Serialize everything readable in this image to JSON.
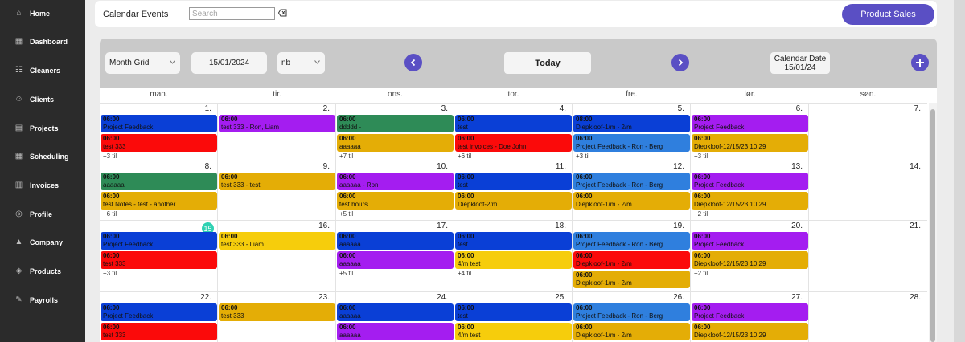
{
  "colors": {
    "purple": "#5a4fc4",
    "blue": "#0a3fd6",
    "violet": "#a41df0",
    "green": "#2e8b57",
    "amber": "#e4ad06",
    "red": "#fb0a0a",
    "mid_blue": "#2f7fde",
    "yellow": "#f6cd0c",
    "today": "#2ed1b2"
  },
  "nav": [
    {
      "label": "Home",
      "icon": "home-icon"
    },
    {
      "label": "Dashboard",
      "icon": "dashboard-icon"
    },
    {
      "label": "Cleaners",
      "icon": "cleaners-icon"
    },
    {
      "label": "Clients",
      "icon": "clients-icon"
    },
    {
      "label": "Projects",
      "icon": "projects-icon"
    },
    {
      "label": "Scheduling",
      "icon": "scheduling-icon"
    },
    {
      "label": "Invoices",
      "icon": "invoices-icon"
    },
    {
      "label": "Profile",
      "icon": "profile-icon"
    },
    {
      "label": "Company",
      "icon": "company-icon"
    },
    {
      "label": "Products",
      "icon": "products-icon"
    },
    {
      "label": "Payrolls",
      "icon": "payrolls-icon"
    }
  ],
  "header": {
    "title": "Calendar Events",
    "search_placeholder": "Search",
    "product_sales": "Product Sales"
  },
  "toolbar": {
    "view": "Month Grid",
    "date": "15/01/2024",
    "lang": "nb",
    "today": "Today",
    "cal_date_label": "Calendar Date",
    "cal_date_value": "15/01/24"
  },
  "weekdays": [
    "man.",
    "tir.",
    "ons.",
    "tor.",
    "fre.",
    "lør.",
    "søn."
  ],
  "today_day": "15",
  "weeks": [
    {
      "days": [
        "1.",
        "2.",
        "3.",
        "4.",
        "5.",
        "6.",
        "7."
      ],
      "cells": [
        {
          "events": [
            {
              "time": "06:00",
              "title": "Project Feedback",
              "color": "blue"
            },
            {
              "time": "06:00",
              "title": "test 333",
              "color": "red"
            }
          ],
          "more": "+3 til"
        },
        {
          "events": [
            {
              "time": "06:00",
              "title": "test 333 - Ron, Liam",
              "color": "violet"
            }
          ],
          "more": ""
        },
        {
          "events": [
            {
              "time": "06:00",
              "title": "ddddd -",
              "color": "green"
            },
            {
              "time": "06:00",
              "title": "aaaaaa",
              "color": "amber"
            }
          ],
          "more": "+7 til"
        },
        {
          "events": [
            {
              "time": "06:00",
              "title": "test",
              "color": "blue"
            },
            {
              "time": "06:00",
              "title": "test invoices - Doe John",
              "color": "red"
            }
          ],
          "more": "+6 til"
        },
        {
          "events": [
            {
              "time": "08:00",
              "title": "Diepkloof-1/m - 2/m",
              "color": "blue"
            },
            {
              "time": "06:00",
              "title": "Project Feedback - Ron - Berg",
              "color": "mid_blue"
            }
          ],
          "more": "+3 til"
        },
        {
          "events": [
            {
              "time": "06:00",
              "title": "Project Feedback",
              "color": "violet"
            },
            {
              "time": "06:00",
              "title": "Diepkloof-12/15/23 10:29",
              "color": "amber"
            }
          ],
          "more": "+3 til"
        },
        {
          "events": [],
          "more": ""
        }
      ]
    },
    {
      "days": [
        "8.",
        "9.",
        "10.",
        "11.",
        "12.",
        "13.",
        "14."
      ],
      "cells": [
        {
          "events": [
            {
              "time": "06:00",
              "title": "aaaaaa",
              "color": "green"
            },
            {
              "time": "06:00",
              "title": "test Notes - test - another",
              "color": "amber"
            }
          ],
          "more": "+6 til"
        },
        {
          "events": [
            {
              "time": "06:00",
              "title": "test 333 - test",
              "color": "amber"
            }
          ],
          "more": ""
        },
        {
          "events": [
            {
              "time": "06:00",
              "title": "aaaaaa - Ron",
              "color": "violet"
            },
            {
              "time": "06:00",
              "title": "test hours",
              "color": "amber"
            }
          ],
          "more": "+5 til"
        },
        {
          "events": [
            {
              "time": "06:00",
              "title": "test",
              "color": "blue"
            },
            {
              "time": "06:00",
              "title": "Diepkloof-2/m",
              "color": "amber"
            }
          ],
          "more": ""
        },
        {
          "events": [
            {
              "time": "06:00",
              "title": "Project Feedback - Ron - Berg",
              "color": "mid_blue"
            },
            {
              "time": "06:00",
              "title": "Diepkloof-1/m - 2/m",
              "color": "amber"
            }
          ],
          "more": ""
        },
        {
          "events": [
            {
              "time": "06:00",
              "title": "Project Feedback",
              "color": "violet"
            },
            {
              "time": "06:00",
              "title": "Diepkloof-12/15/23 10:29",
              "color": "amber"
            }
          ],
          "more": "+2 til"
        },
        {
          "events": [],
          "more": ""
        }
      ]
    },
    {
      "days": [
        "",
        "16.",
        "17.",
        "18.",
        "19.",
        "20.",
        "21."
      ],
      "cells": [
        {
          "events": [
            {
              "time": "06:00",
              "title": "Project Feedback",
              "color": "blue"
            },
            {
              "time": "06:00",
              "title": "test 333",
              "color": "red"
            }
          ],
          "more": "+3 til"
        },
        {
          "events": [
            {
              "time": "06:00",
              "title": "test 333 - Liam",
              "color": "yellow"
            }
          ],
          "more": ""
        },
        {
          "events": [
            {
              "time": "06:00",
              "title": "aaaaaa",
              "color": "blue"
            },
            {
              "time": "06:00",
              "title": "aaaaaa",
              "color": "violet"
            }
          ],
          "more": "+5 til"
        },
        {
          "events": [
            {
              "time": "06:00",
              "title": "test",
              "color": "blue"
            },
            {
              "time": "06:00",
              "title": "4/m test",
              "color": "yellow"
            }
          ],
          "more": "+4 til"
        },
        {
          "events": [
            {
              "time": "06:00",
              "title": "Project Feedback - Ron - Berg",
              "color": "mid_blue"
            },
            {
              "time": "06:00",
              "title": "Diepkloof-1/m - 2/m",
              "color": "red"
            },
            {
              "time": "06:00",
              "title": "Diepkloof-1/m - 2/m",
              "color": "amber"
            }
          ],
          "more": ""
        },
        {
          "events": [
            {
              "time": "06:00",
              "title": "Project Feedback",
              "color": "violet"
            },
            {
              "time": "06:00",
              "title": "Diepkloof-12/15/23 10:29",
              "color": "amber"
            }
          ],
          "more": "+2 til"
        },
        {
          "events": [],
          "more": ""
        }
      ]
    },
    {
      "days": [
        "22.",
        "23.",
        "24.",
        "25.",
        "26.",
        "27.",
        "28."
      ],
      "cells": [
        {
          "events": [
            {
              "time": "06:00",
              "title": "Project Feedback",
              "color": "blue"
            },
            {
              "time": "06:00",
              "title": "test 333",
              "color": "red"
            }
          ],
          "more": ""
        },
        {
          "events": [
            {
              "time": "06:00",
              "title": "test 333",
              "color": "amber"
            }
          ],
          "more": ""
        },
        {
          "events": [
            {
              "time": "06:00",
              "title": "aaaaaa",
              "color": "blue"
            },
            {
              "time": "06:00",
              "title": "aaaaaa",
              "color": "violet"
            }
          ],
          "more": ""
        },
        {
          "events": [
            {
              "time": "06:00",
              "title": "test",
              "color": "blue"
            },
            {
              "time": "06:00",
              "title": "4/m test",
              "color": "yellow"
            }
          ],
          "more": ""
        },
        {
          "events": [
            {
              "time": "06:00",
              "title": "Project Feedback - Ron - Berg",
              "color": "mid_blue"
            },
            {
              "time": "06:00",
              "title": "Diepkloof-1/m - 2/m",
              "color": "amber"
            }
          ],
          "more": ""
        },
        {
          "events": [
            {
              "time": "06:00",
              "title": "Project Feedback",
              "color": "violet"
            },
            {
              "time": "06:00",
              "title": "Diepkloof-12/15/23 10:29",
              "color": "amber"
            }
          ],
          "more": ""
        },
        {
          "events": [],
          "more": ""
        }
      ]
    }
  ]
}
